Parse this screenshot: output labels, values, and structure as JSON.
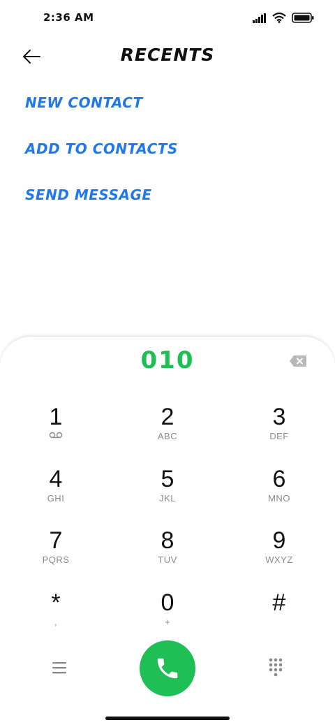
{
  "status_bar": {
    "time": "2:36 AM",
    "icons": [
      "signal-icon",
      "wifi-icon",
      "battery-icon"
    ]
  },
  "header": {
    "back_icon": "arrow-left-icon",
    "title": "RECENTS"
  },
  "actions": [
    {
      "label": "NEW CONTACT"
    },
    {
      "label": "ADD TO CONTACTS"
    },
    {
      "label": "SEND MESSAGE"
    }
  ],
  "dialer": {
    "number": "010",
    "backspace_icon": "backspace-icon",
    "keys": [
      {
        "digit": "1",
        "letters": ""
      },
      {
        "digit": "2",
        "letters": "ABC"
      },
      {
        "digit": "3",
        "letters": "DEF"
      },
      {
        "digit": "4",
        "letters": "GHI"
      },
      {
        "digit": "5",
        "letters": "JKL"
      },
      {
        "digit": "6",
        "letters": "MNO"
      },
      {
        "digit": "7",
        "letters": "PQRS"
      },
      {
        "digit": "8",
        "letters": "TUV"
      },
      {
        "digit": "9",
        "letters": "WXYZ"
      },
      {
        "digit": "*",
        "letters": ","
      },
      {
        "digit": "0",
        "letters": "+"
      },
      {
        "digit": "#",
        "letters": ""
      }
    ],
    "voicemail_icon": "voicemail-icon",
    "menu_icon": "menu-icon",
    "call_icon": "phone-icon",
    "keypad_icon": "dialpad-icon"
  },
  "colors": {
    "accent_blue": "#1f78ee",
    "call_green": "#1fbf56"
  }
}
